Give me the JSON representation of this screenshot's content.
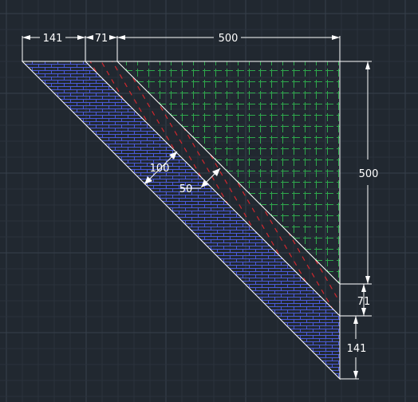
{
  "drawing": {
    "colors": {
      "background": "#212830",
      "grid_minor": "#2b323c",
      "grid_major": "#36404b",
      "outline": "#ffffff",
      "hatch_blue": "#4a5ad8",
      "hatch_red": "#e0262c",
      "hatch_green": "#2ea84c",
      "dimension": "#ffffff"
    },
    "dimensions": {
      "top_left": "141",
      "top_middle": "71",
      "top_right": "500",
      "right_top": "500",
      "right_middle": "71",
      "right_bottom": "141",
      "diag_outer": "100",
      "diag_inner": "50"
    }
  }
}
